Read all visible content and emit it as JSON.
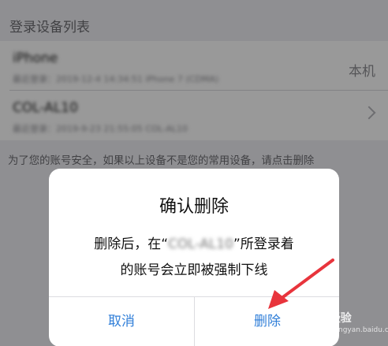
{
  "section": {
    "title": "登录设备列表"
  },
  "devices": [
    {
      "name": "iPhone",
      "detail": "最近登录：2019-12-4 14:34:51 iPhone 7 (CDMA)",
      "tag": "本机"
    },
    {
      "name": "COL-AL10",
      "detail": "最近登录：2019-9-23 21:55:05 COL-AL10",
      "tag": ""
    }
  ],
  "notice": "为了您的账号安全，如果以上设备不是您的常用设备，请点击删除",
  "dialog": {
    "title": "确认删除",
    "msg_prefix": "删除后，在“",
    "msg_device": "COL-AL10",
    "msg_suffix": "”所登录着",
    "msg_line2": "的账号会立即被强制下线",
    "cancel_label": "取消",
    "confirm_label": "删除"
  },
  "watermark": {
    "brand": "Baidu 经验",
    "sub": "jingyan.baidu.com"
  },
  "colors": {
    "accent_blue": "#2f7ed8",
    "arrow_red": "#e8343c",
    "background": "#efeff4"
  }
}
